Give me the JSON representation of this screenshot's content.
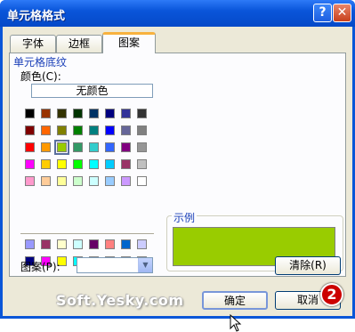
{
  "window": {
    "title": "单元格格式",
    "help": "?",
    "close": "✕"
  },
  "tabs": [
    {
      "label": "字体",
      "active": false
    },
    {
      "label": "边框",
      "active": false
    },
    {
      "label": "图案",
      "active": true
    }
  ],
  "shading": {
    "group_title": "单元格底纹",
    "color_label": "颜色(C):",
    "no_color": "无颜色",
    "palette_main": [
      [
        "#000000",
        "#993300",
        "#333300",
        "#003300",
        "#003366",
        "#000080",
        "#333399",
        "#333333"
      ],
      [
        "#800000",
        "#ff6600",
        "#808000",
        "#008000",
        "#008080",
        "#0000ff",
        "#666699",
        "#808080"
      ],
      [
        "#ff0000",
        "#ff9900",
        "#99cc00",
        "#339966",
        "#33cccc",
        "#3366ff",
        "#800080",
        "#969696"
      ],
      [
        "#ff00ff",
        "#ffcc00",
        "#ffff00",
        "#00ff00",
        "#00ffff",
        "#00ccff",
        "#993366",
        "#c0c0c0"
      ],
      [
        "#ff99cc",
        "#ffcc99",
        "#ffff99",
        "#ccffcc",
        "#ccffff",
        "#99ccff",
        "#cc99ff",
        "#ffffff"
      ]
    ],
    "palette_chart": [
      [
        "#9999ff",
        "#993366",
        "#ffffcc",
        "#ccffff",
        "#660066",
        "#ff8080",
        "#0066cc",
        "#ccccff"
      ],
      [
        "#000080",
        "#ff00ff",
        "#ffff00",
        "#00ffff",
        "#800080",
        "#800000",
        "#008080",
        "#0000ff"
      ]
    ],
    "selected_color": "#99cc00",
    "pattern_label": "图案(P):",
    "pattern_value": ""
  },
  "sample": {
    "title": "示例",
    "color": "#99cc00"
  },
  "buttons": {
    "clear": "清除(R)",
    "ok": "确定",
    "cancel": "取消"
  },
  "overlay": {
    "watermark": "Soft.Yesky.com",
    "step_badge": "2"
  }
}
